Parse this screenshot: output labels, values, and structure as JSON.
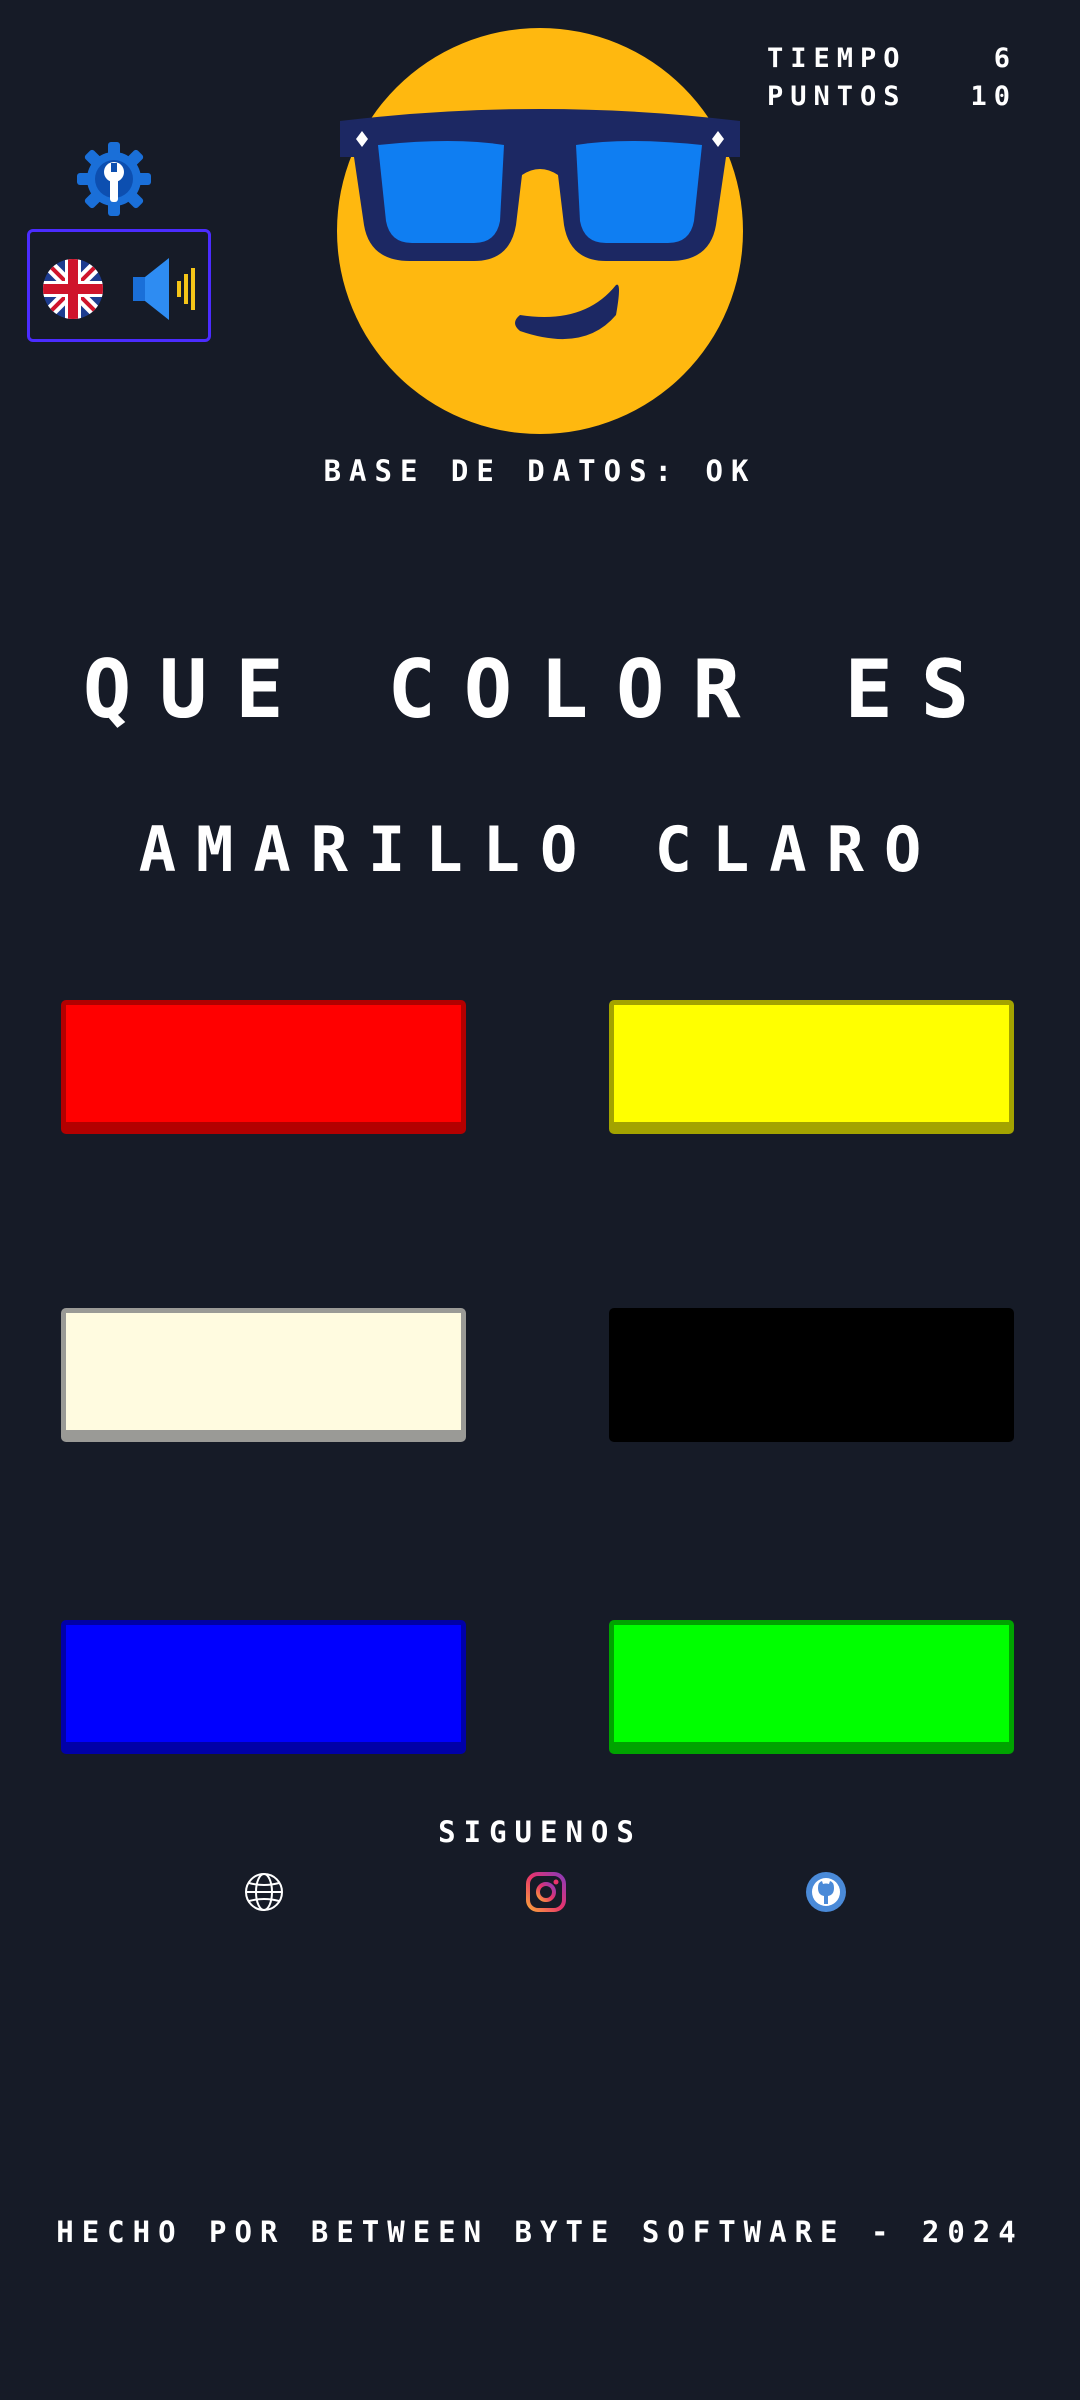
{
  "stats": {
    "time_label": "TIEMPO",
    "time_value": "6",
    "points_label": "PUNTOS",
    "points_value": "10"
  },
  "db_status": {
    "label": "BASE DE DATOS:",
    "value": "OK"
  },
  "question": "QUE COLOR ES",
  "target_color": "AMARILLO CLARO",
  "color_options": [
    {
      "name": "red",
      "hex": "#ff0000"
    },
    {
      "name": "yellow",
      "hex": "#ffff00"
    },
    {
      "name": "light-yellow",
      "hex": "#fffbe0"
    },
    {
      "name": "black",
      "hex": "#000000"
    },
    {
      "name": "blue",
      "hex": "#0000ff"
    },
    {
      "name": "green",
      "hex": "#00ff00"
    }
  ],
  "follow_label": "SIGUENOS",
  "social_icons": [
    "globe-icon",
    "instagram-icon",
    "github-icon"
  ],
  "footer": "HECHO POR BETWEEN BYTE SOFTWARE - 2024",
  "icons": {
    "settings": "gear-wrench-icon",
    "language": "uk-flag-icon",
    "sound": "speaker-icon",
    "mascot": "sunglasses-emoji"
  },
  "colors": {
    "background": "#161b27",
    "panel_border": "#4b2cff",
    "text": "#ffffff"
  }
}
